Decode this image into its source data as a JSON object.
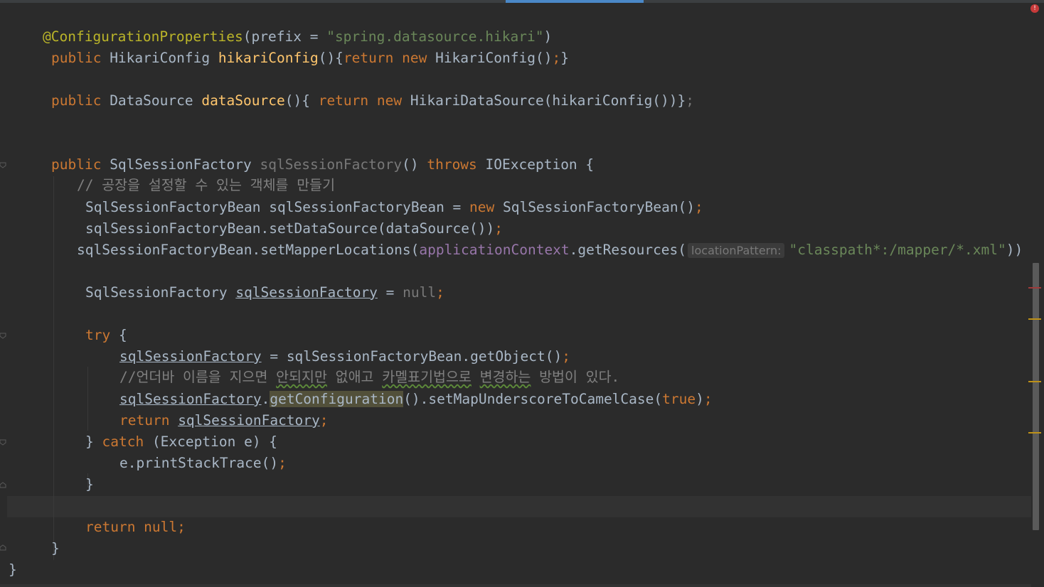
{
  "editor": {
    "icons": {
      "error": "error-stripe-icon",
      "fold": "fold-marker-icon"
    },
    "colors": {
      "background": "#2b2b2b",
      "keyword": "#cc7832",
      "method": "#ffc66d",
      "string": "#6a8759",
      "annotation": "#bbb529",
      "comment": "#808080",
      "field": "#9876aa",
      "text": "#a9b7c6"
    },
    "lines": [
      {
        "tokens": [
          [
            "ann",
            "@ConfigurationProperties"
          ],
          [
            "",
            "("
          ],
          [
            "",
            "prefix"
          ],
          [
            "",
            " = "
          ],
          [
            "str",
            "\"spring.datasource.hikari\""
          ],
          [
            "",
            ")"
          ]
        ]
      },
      {
        "tokens": [
          [
            "kw",
            "public "
          ],
          [
            "",
            "HikariConfig "
          ],
          [
            "fn",
            "hikariConfig"
          ],
          [
            "",
            "(){"
          ],
          [
            "kw",
            "return new "
          ],
          [
            "",
            "HikariConfig()"
          ],
          [
            "kw",
            ";"
          ],
          [
            "",
            "}"
          ]
        ]
      },
      {
        "tokens": []
      },
      {
        "tokens": [
          [
            "kw",
            "public "
          ],
          [
            "",
            "DataSource "
          ],
          [
            "fn",
            "dataSource"
          ],
          [
            "",
            "(){ "
          ],
          [
            "kw",
            "return new "
          ],
          [
            "",
            "HikariDataSource(hikariConfig())}"
          ],
          [
            "grey",
            ";"
          ]
        ]
      },
      {
        "tokens": []
      },
      {
        "tokens": []
      },
      {
        "tokens": [
          [
            "kw",
            "public "
          ],
          [
            "",
            "SqlSessionFactory "
          ],
          [
            "grey",
            "sqlSessionFactory"
          ],
          [
            "",
            "() "
          ],
          [
            "kw",
            "throws "
          ],
          [
            "",
            "IOException {"
          ]
        ]
      },
      {
        "tokens": [
          [
            "cm",
            "// 공장을 설정할 수 있는 객체를 만들기"
          ]
        ]
      },
      {
        "tokens": [
          [
            "",
            "SqlSessionFactoryBean sqlSessionFactoryBean = "
          ],
          [
            "kw",
            "new "
          ],
          [
            "",
            "SqlSessionFactoryBean()"
          ],
          [
            "kw",
            ";"
          ]
        ]
      },
      {
        "tokens": [
          [
            "",
            "sqlSessionFactoryBean.setDataSource(dataSource())"
          ],
          [
            "kw",
            ";"
          ]
        ]
      },
      {
        "tokens": [
          [
            "",
            "sqlSessionFactoryBean.setMapperLocations("
          ],
          [
            "fld",
            "applicationContext"
          ],
          [
            "",
            ".getResources("
          ],
          [
            "hint",
            "locationPattern:"
          ],
          [
            "str",
            "\"classpath*:/mapper/*.xml\""
          ],
          [
            "",
            "))"
          ]
        ]
      },
      {
        "tokens": []
      },
      {
        "tokens": [
          [
            "",
            "SqlSessionFactory "
          ],
          [
            "ul",
            "sqlSessionFactory"
          ],
          [
            "",
            " = "
          ],
          [
            "grey",
            "null"
          ],
          [
            "kw",
            ";"
          ]
        ]
      },
      {
        "tokens": []
      },
      {
        "tokens": [
          [
            "kw",
            "try "
          ],
          [
            "",
            "{"
          ]
        ]
      },
      {
        "tokens": [
          [
            "ul",
            "sqlSessionFactory"
          ],
          [
            "",
            " = sqlSessionFactoryBean.getObject()"
          ],
          [
            "kw",
            ";"
          ]
        ]
      },
      {
        "tokens": [
          [
            "cm",
            "//언더바 이름을 지으면 "
          ],
          [
            "cm typo",
            "안되지만"
          ],
          [
            "cm",
            " 없애고 "
          ],
          [
            "cm typo",
            "카멜표기법으로"
          ],
          [
            "cm",
            " "
          ],
          [
            "cm typo",
            "변경하는"
          ],
          [
            "cm",
            " 방법이 있다."
          ]
        ]
      },
      {
        "tokens": [
          [
            "ul",
            "sqlSessionFactory"
          ],
          [
            "",
            "."
          ],
          [
            "hl",
            "getConfiguration"
          ],
          [
            "",
            "().setMapUnderscoreToCamelCase("
          ],
          [
            "kw",
            "true"
          ],
          [
            "",
            ")"
          ],
          [
            "kw",
            ";"
          ]
        ]
      },
      {
        "tokens": [
          [
            "kw",
            "return "
          ],
          [
            "ul",
            "sqlSessionFactory"
          ],
          [
            "kw",
            ";"
          ]
        ]
      },
      {
        "tokens": [
          [
            "",
            "} "
          ],
          [
            "kw",
            "catch "
          ],
          [
            "",
            "(Exception e) {"
          ]
        ]
      },
      {
        "tokens": [
          [
            "",
            "e.printStackTrace()"
          ],
          [
            "kw",
            ";"
          ]
        ]
      },
      {
        "tokens": [
          [
            "",
            "}"
          ]
        ]
      },
      {
        "tokens": []
      },
      {
        "tokens": [
          [
            "kw",
            "return null;"
          ]
        ]
      },
      {
        "tokens": [
          [
            "",
            "}"
          ]
        ]
      },
      {
        "tokens": [
          [
            "",
            "}"
          ]
        ]
      }
    ]
  }
}
